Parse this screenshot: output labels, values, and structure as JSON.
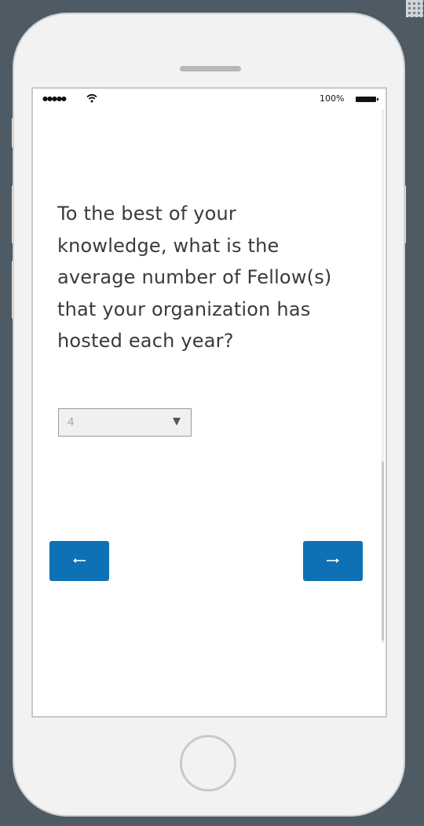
{
  "status_bar": {
    "signal": "●●●●●",
    "battery_percent": "100%"
  },
  "question": {
    "text": "To the best of your knowledge, what is the average number of Fellow(s) that your organization has hosted each year?"
  },
  "answer_select": {
    "selected_value": "4"
  },
  "navigation": {
    "back_icon": "arrow-left-icon",
    "next_icon": "arrow-right-icon"
  },
  "colors": {
    "button": "#0f71b5",
    "page_background": "#4e5a64",
    "phone_body": "#f2f2f2"
  }
}
